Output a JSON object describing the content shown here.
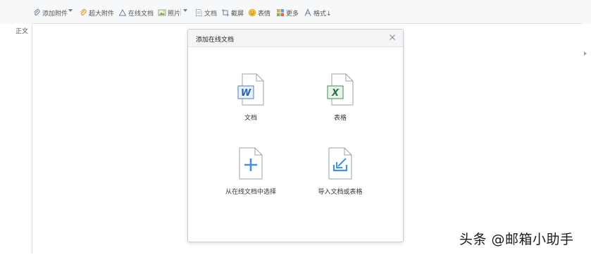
{
  "toolbar": {
    "attach": "添加附件",
    "big_attach": "超大附件",
    "online_doc": "在线文档",
    "photo": "照片",
    "doc": "文档",
    "screenshot": "截屏",
    "emoji": "表情",
    "more": "更多",
    "format": "格式↓"
  },
  "editor": {
    "label": "正文"
  },
  "dialog": {
    "title": "添加在线文档",
    "options": [
      {
        "label": "文档",
        "icon": "word-doc-icon",
        "badge": "W"
      },
      {
        "label": "表格",
        "icon": "excel-sheet-icon",
        "badge": "X"
      },
      {
        "label": "从在线文档中选择",
        "icon": "plus-file-icon"
      },
      {
        "label": "导入文档或表格",
        "icon": "import-file-icon"
      }
    ]
  },
  "watermark": "头条 @邮箱小助手",
  "colors": {
    "accent": "#4a90d9",
    "word": "#2b65b0",
    "excel": "#217346",
    "toolbar_bg": "#f7f8fa"
  }
}
